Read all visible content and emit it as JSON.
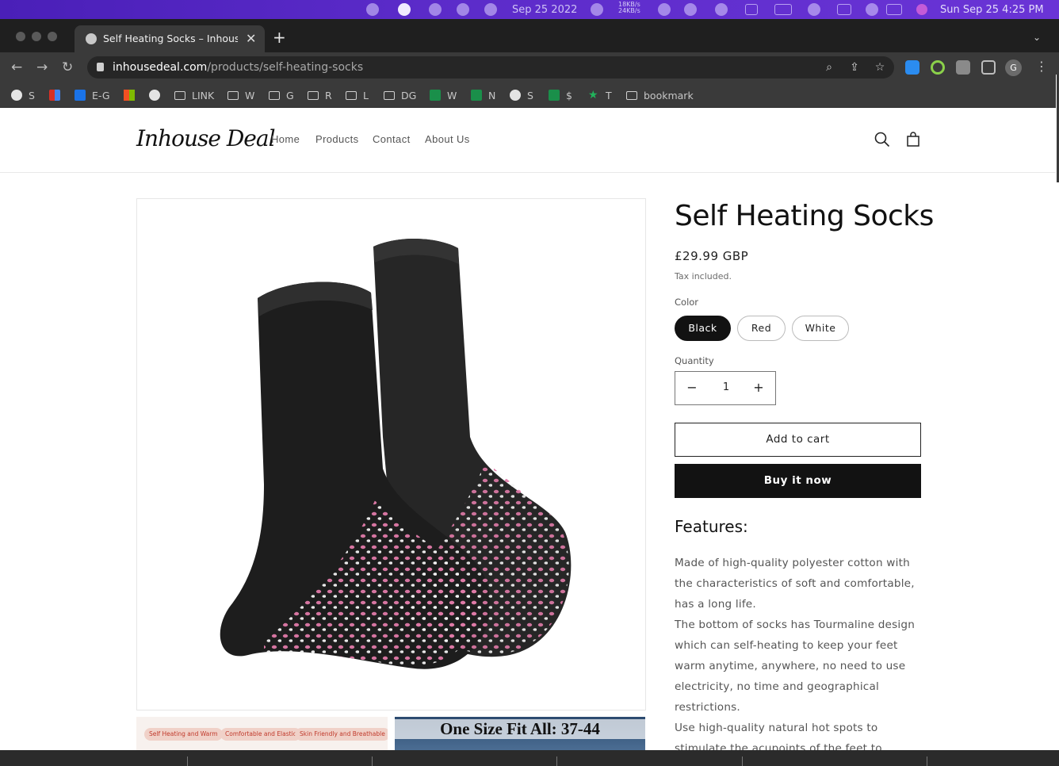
{
  "menubar": {
    "date_text": "Sep 25 2022",
    "net_up": "18KB/s",
    "net_down": "24KB/s",
    "clock": "Sun Sep 25  4:25 PM"
  },
  "browser": {
    "tab_title": "Self Heating Socks – InhouseDeal",
    "url_host": "inhousedeal.com",
    "url_path": "/products/self-heating-socks",
    "profile_initial": "G",
    "bookmarks": [
      {
        "label": "S",
        "icon": "globe-icon"
      },
      {
        "label": "",
        "icon": "gmail-icon"
      },
      {
        "label": "E-G",
        "icon": "outlook-icon"
      },
      {
        "label": "",
        "icon": "microsoft-icon"
      },
      {
        "label": "",
        "icon": "globe-icon"
      },
      {
        "label": "LINK",
        "icon": "folder-icon"
      },
      {
        "label": "W",
        "icon": "folder-icon"
      },
      {
        "label": "G",
        "icon": "folder-icon"
      },
      {
        "label": "R",
        "icon": "folder-icon"
      },
      {
        "label": "L",
        "icon": "folder-icon"
      },
      {
        "label": "DG",
        "icon": "folder-icon"
      },
      {
        "label": "W",
        "icon": "sheets-icon"
      },
      {
        "label": "N",
        "icon": "sheets-icon"
      },
      {
        "label": "S",
        "icon": "globe-icon"
      },
      {
        "label": "$",
        "icon": "sheets-icon"
      },
      {
        "label": "T",
        "icon": "star-icon"
      },
      {
        "label": "bookmark",
        "icon": "folder-icon"
      }
    ]
  },
  "site": {
    "logo": "Inhouse Deal",
    "nav": [
      "Home",
      "Products",
      "Contact",
      "About Us"
    ]
  },
  "product": {
    "title": "Self Heating Socks",
    "price": "£29.99 GBP",
    "tax_note": "Tax included.",
    "color_label": "Color",
    "colors": [
      "Black",
      "Red",
      "White"
    ],
    "selected_color": "Black",
    "quantity_label": "Quantity",
    "quantity": "1",
    "decrease_symbol": "−",
    "increase_symbol": "+",
    "add_to_cart": "Add to cart",
    "buy_now": "Buy it now",
    "features_heading": "Features:",
    "description": [
      "Made of high-quality polyester cotton with the characteristics of soft and comfortable, has a long life.",
      "The bottom of socks has Tourmaline design which can self-heating to keep your feet warm anytime, anywhere, no need to use electricity, no time and geographical restrictions.",
      "Use high-quality natural hot spots to stimulate the acupoints of the feet to achieve a massage effect, relieve leg fatigue, regulate blood"
    ],
    "thumb1_tags": [
      "Self Heating and Warm",
      "Comfortable and Elastic",
      "Skin Friendly and Breathable"
    ],
    "thumb2_caption": "One Size Fit All: 37-44"
  }
}
